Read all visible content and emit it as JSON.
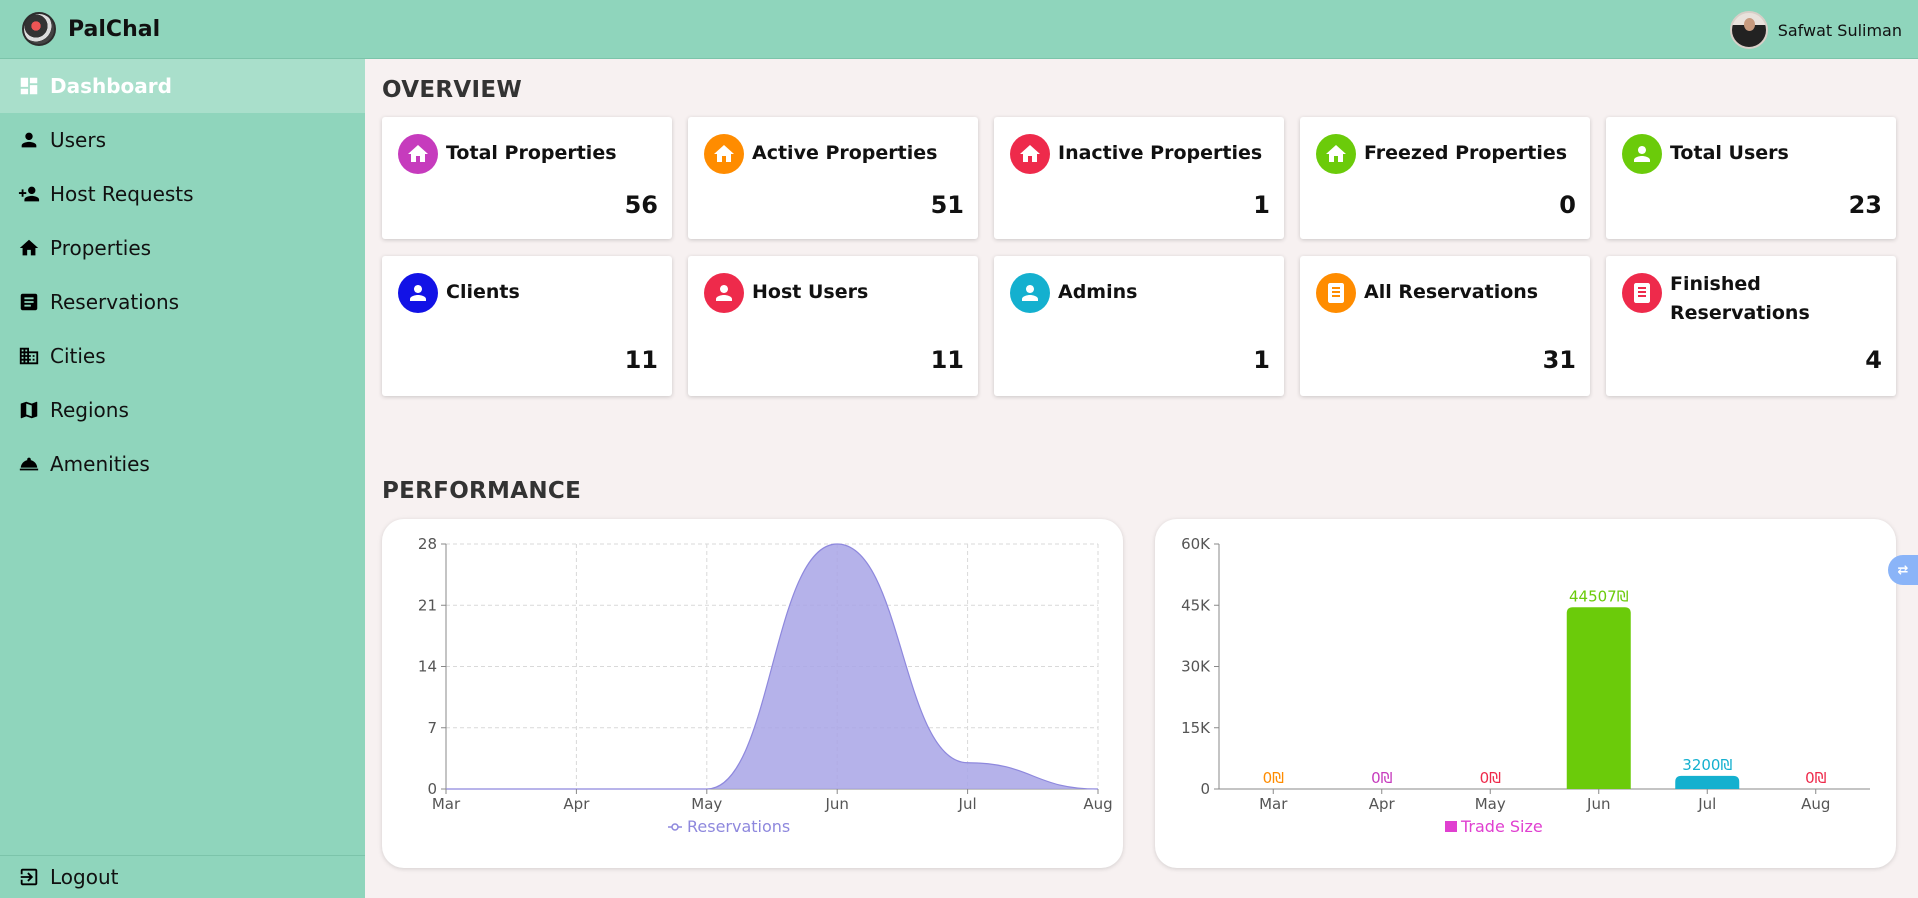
{
  "app": {
    "name": "PalChal"
  },
  "user": {
    "name": "Safwat Suliman"
  },
  "sidebar": {
    "items": [
      {
        "label": "Dashboard",
        "icon": "dashboard-icon"
      },
      {
        "label": "Users",
        "icon": "person-icon"
      },
      {
        "label": "Host Requests",
        "icon": "person-add-icon"
      },
      {
        "label": "Properties",
        "icon": "home-icon"
      },
      {
        "label": "Reservations",
        "icon": "list-icon"
      },
      {
        "label": "Cities",
        "icon": "city-icon"
      },
      {
        "label": "Regions",
        "icon": "map-icon"
      },
      {
        "label": "Amenities",
        "icon": "room-service-icon"
      }
    ],
    "logout": "Logout"
  },
  "overview": {
    "title": "OVERVIEW",
    "cards": [
      {
        "label": "Total Properties",
        "value": "56",
        "icon": "home-icon",
        "color": "#c63bbd"
      },
      {
        "label": "Active Properties",
        "value": "51",
        "icon": "home-icon",
        "color": "#ff8c00"
      },
      {
        "label": "Inactive Properties",
        "value": "1",
        "icon": "home-icon",
        "color": "#ee2a4b"
      },
      {
        "label": "Freezed Properties",
        "value": "0",
        "icon": "home-icon",
        "color": "#6bcb0a"
      },
      {
        "label": "Total Users",
        "value": "23",
        "icon": "person-icon",
        "color": "#6bcb0a"
      },
      {
        "label": "Clients",
        "value": "11",
        "icon": "person-icon",
        "color": "#1212e6"
      },
      {
        "label": "Host Users",
        "value": "11",
        "icon": "person-icon",
        "color": "#ee2a4b"
      },
      {
        "label": "Admins",
        "value": "1",
        "icon": "person-icon",
        "color": "#14b0cf"
      },
      {
        "label": "All Reservations",
        "value": "31",
        "icon": "receipt-icon",
        "color": "#ff8c00"
      },
      {
        "label": "Finished Reservations",
        "value": "4",
        "icon": "receipt-icon",
        "color": "#ee2a4b"
      }
    ]
  },
  "performance": {
    "title": "PERFORMANCE"
  },
  "chart_data": [
    {
      "type": "area",
      "categories": [
        "Mar",
        "Apr",
        "May",
        "Jun",
        "Jul",
        "Aug"
      ],
      "series": [
        {
          "name": "Reservations",
          "values": [
            0,
            0,
            0,
            28,
            3,
            0
          ],
          "color": "#a8a4e6"
        }
      ],
      "yticks": [
        "0",
        "7",
        "14",
        "21",
        "28"
      ],
      "ylim": [
        0,
        28
      ],
      "grid": true,
      "legend": "bottom"
    },
    {
      "type": "bar",
      "categories": [
        "Mar",
        "Apr",
        "May",
        "Jun",
        "Jul",
        "Aug"
      ],
      "series": [
        {
          "name": "Trade Size",
          "values": [
            0,
            0,
            0,
            44507,
            3200,
            0
          ],
          "color": "#e040d0"
        }
      ],
      "data_labels": [
        "0₪",
        "0₪",
        "0₪",
        "44507₪",
        "3200₪",
        "0₪"
      ],
      "bar_colors": [
        "#ff8c00",
        "#c63bbd",
        "#ee2a4b",
        "#6bcb0a",
        "#14b0cf",
        "#ee2a4b"
      ],
      "yticks": [
        "0",
        "15K",
        "30K",
        "45K",
        "60K"
      ],
      "ylim": [
        0,
        60000
      ],
      "grid": false,
      "legend": "bottom"
    }
  ]
}
